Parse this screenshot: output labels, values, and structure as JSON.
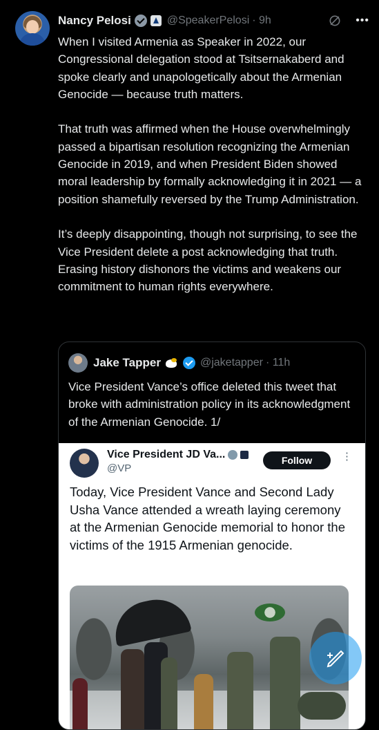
{
  "post": {
    "author_name": "Nancy Pelosi",
    "handle": "@SpeakerPelosi",
    "time": "· 9h",
    "paragraphs": [
      "When I visited Armenia as Speaker in 2022, our Congressional delegation stood at Tsitsernakaberd and spoke clearly and unapologetically about the Armenian Genocide — because truth matters.",
      "That truth was affirmed when the House overwhelmingly passed a bipartisan resolution recognizing the Armenian Genocide in 2019, and when President Biden showed moral leadership by formally acknowledging it in 2021 — a position shamefully reversed by the Trump Administration.",
      "It’s deeply disappointing, though not surprising, to see the Vice President delete a post acknowledging that truth. Erasing history dishonors the victims and weakens our commitment to human rights everywhere."
    ],
    "more_label": "•••"
  },
  "quote": {
    "author_name": "Jake Tapper",
    "handle": "@jaketapper",
    "time": "· 11h",
    "text": "Vice President Vance’s office deleted this tweet that broke with administration policy in its acknowledgment of the Armenian Genocide. 1/"
  },
  "screenshot": {
    "author_name": "Vice President JD Va...",
    "handle": "@VP",
    "follow_label": "Follow",
    "more_label": "⋮",
    "text": "Today, Vice President Vance and Second Lady Usha Vance attended a wreath laying ceremony at the Armenian Genocide memorial to honor the victims of the 1915 Armenian genocide."
  },
  "icons": {
    "verified": "verified-badge-icon",
    "gov": "government-badge-icon",
    "grok": "grok-icon",
    "compose": "compose-post-icon"
  },
  "colors": {
    "background": "#000000",
    "text": "#e7e9ea",
    "muted": "#71767b",
    "accent": "#1d9bf0"
  }
}
